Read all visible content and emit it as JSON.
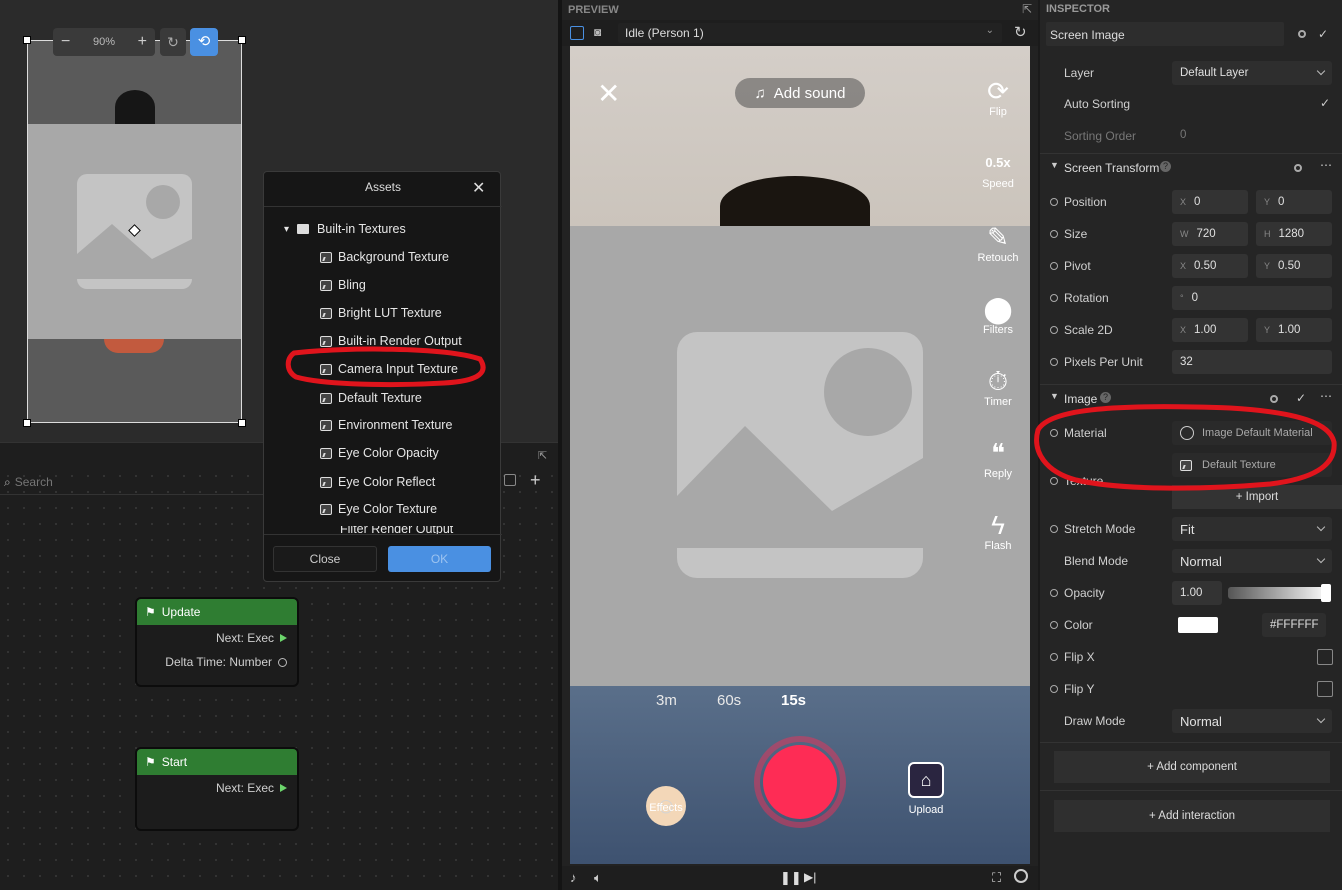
{
  "scene": {
    "zoom": "90%"
  },
  "graph": {
    "search_placeholder": "Search",
    "update_node": {
      "title": "Update",
      "next": "Next: Exec",
      "delta": "Delta Time: Number"
    },
    "start_node": {
      "title": "Start",
      "next": "Next: Exec"
    }
  },
  "assets": {
    "title": "Assets",
    "folder": "Built-in Textures",
    "items": [
      "Background Texture",
      "Bling",
      "Bright LUT Texture",
      "Built-in Render Output",
      "Camera Input Texture",
      "Default Texture",
      "Environment Texture",
      "Eye Color Opacity",
      "Eye Color Reflect",
      "Eye Color Texture",
      "Filter Render Output"
    ],
    "close": "Close",
    "ok": "OK"
  },
  "preview": {
    "label": "PREVIEW",
    "person": "Idle (Person 1)",
    "add_sound": "Add sound",
    "side": [
      {
        "icon": "flip-icon",
        "label": "Flip",
        "glyph": "⟳"
      },
      {
        "icon": "speed-icon",
        "label": "Speed",
        "glyph": "0.5x"
      },
      {
        "icon": "retouch-icon",
        "label": "Retouch",
        "glyph": "✎"
      },
      {
        "icon": "filters-icon",
        "label": "Filters",
        "glyph": "⬤"
      },
      {
        "icon": "timer-icon",
        "label": "Timer",
        "glyph": "⏱"
      },
      {
        "icon": "reply-icon",
        "label": "Reply",
        "glyph": "❝"
      },
      {
        "icon": "flash-icon",
        "label": "Flash",
        "glyph": "ϟ"
      }
    ],
    "durations": [
      "3m",
      "60s",
      "15s"
    ],
    "effects": "Effects",
    "upload": "Upload"
  },
  "inspector": {
    "title": "INSPECTOR",
    "object_name": "Screen Image",
    "layer_label": "Layer",
    "layer_value": "Default Layer",
    "auto_sorting": "Auto Sorting",
    "sorting_order": "Sorting Order",
    "sorting_value": "0",
    "screen_transform": "Screen Transform",
    "position": "Position",
    "pos_x": "0",
    "pos_y": "0",
    "size": "Size",
    "size_w": "720",
    "size_h": "1280",
    "pivot": "Pivot",
    "pivot_x": "0.50",
    "pivot_y": "0.50",
    "rotation": "Rotation",
    "rot": "0",
    "scale": "Scale 2D",
    "scale_x": "1.00",
    "scale_y": "1.00",
    "ppu": "Pixels Per Unit",
    "ppu_value": "32",
    "image": "Image",
    "material": "Material",
    "material_value": "Image Default Material",
    "texture": "Texture",
    "texture_value": "Default Texture",
    "import": "+ Import",
    "stretch": "Stretch Mode",
    "stretch_value": "Fit",
    "blend": "Blend Mode",
    "blend_value": "Normal",
    "opacity": "Opacity",
    "opacity_value": "1.00",
    "color": "Color",
    "color_value": "#FFFFFF",
    "flipx": "Flip X",
    "flipy": "Flip Y",
    "draw": "Draw Mode",
    "draw_value": "Normal",
    "add_component": "+ Add component",
    "add_interaction": "+ Add interaction"
  },
  "colors": {
    "accent": "#4a90e2",
    "record": "#fe2c55",
    "annotation": "#e0141c",
    "node_green": "#2f7d32"
  }
}
